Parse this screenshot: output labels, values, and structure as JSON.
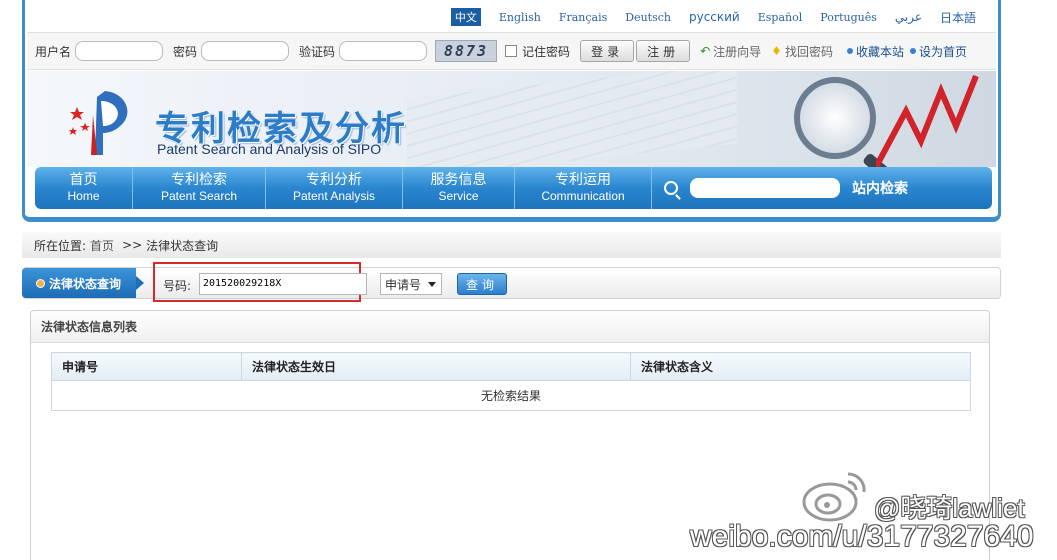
{
  "languages": [
    "中文",
    "English",
    "Français",
    "Deutsch",
    "русский",
    "Español",
    "Português",
    "عربي",
    "日本語"
  ],
  "login": {
    "username_label": "用户名",
    "password_label": "密码",
    "captcha_label": "验证码",
    "captcha_code": "8873",
    "remember_label": "记住密码",
    "login_button": "登录",
    "register_button": "注册",
    "register_guide": "注册向导",
    "recover_password": "找回密码",
    "bookmark_site": "收藏本站",
    "set_homepage": "设为首页"
  },
  "banner": {
    "title_cn": "专利检索及分析",
    "title_en": "Patent Search and Analysis of SIPO"
  },
  "nav": {
    "items": [
      {
        "cn": "首页",
        "en": "Home"
      },
      {
        "cn": "专利检索",
        "en": "Patent Search"
      },
      {
        "cn": "专利分析",
        "en": "Patent Analysis"
      },
      {
        "cn": "服务信息",
        "en": "Service"
      },
      {
        "cn": "专利运用",
        "en": "Communication"
      }
    ],
    "site_search_label": "站内检索"
  },
  "breadcrumb": {
    "prefix": "所在位置:",
    "home": "首页",
    "separator": ">>",
    "current": "法律状态查询"
  },
  "query": {
    "tab_label": "法律状态查询",
    "number_label": "号码:",
    "number_value": "201520029218X",
    "type_selected": "申请号",
    "search_button": "查询"
  },
  "results": {
    "panel_title": "法律状态信息列表",
    "columns": [
      "申请号",
      "法律状态生效日",
      "法律状态含义"
    ],
    "empty_text": "无检索结果"
  },
  "watermark": {
    "name": "@晓琦lawliet",
    "url": "weibo.com/u/3177327640"
  },
  "colors": {
    "nav_blue": "#2a86cf",
    "highlight_red": "#d52b2b",
    "frame_blue": "#3c8ec9"
  }
}
